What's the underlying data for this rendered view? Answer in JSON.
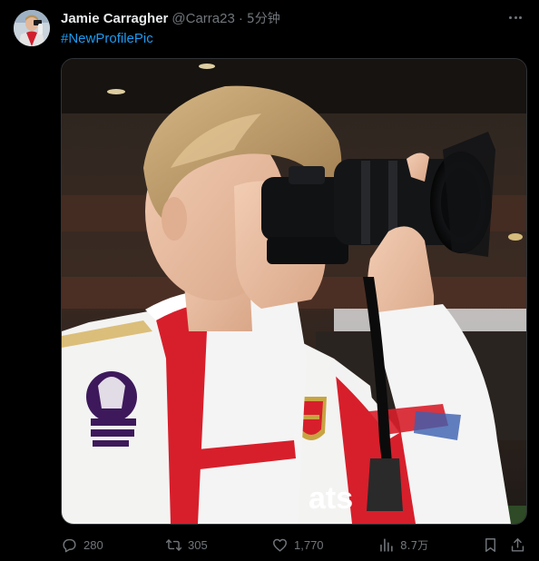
{
  "tweet": {
    "author_name": "Jamie Carragher",
    "handle": "@Carra23",
    "separator": "·",
    "time": "5分钟",
    "text": "#NewProfilePic"
  },
  "media": {
    "kind": "photo",
    "shirt_text": "ats"
  },
  "actions": {
    "replies": "280",
    "retweets": "305",
    "likes": "1,770",
    "views": "8.7万"
  },
  "colors": {
    "background": "#000000",
    "text": "#e7e9ea",
    "secondary": "#71767b",
    "link": "#1d9bf0",
    "border": "#2f3336"
  },
  "icons": [
    "more-icon",
    "reply-icon",
    "retweet-icon",
    "like-icon",
    "views-icon",
    "bookmark-icon",
    "share-icon"
  ]
}
